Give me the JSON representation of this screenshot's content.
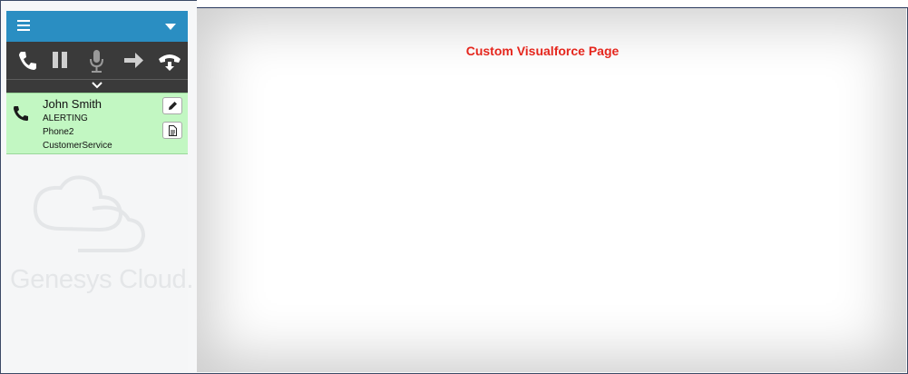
{
  "softphone": {
    "header": {
      "menu_icon": "hamburger-menu-icon",
      "dropdown_icon": "caret-down-icon"
    },
    "controls": [
      {
        "name": "call",
        "icon": "phone-icon"
      },
      {
        "name": "hold",
        "icon": "pause-icon"
      },
      {
        "name": "mute",
        "icon": "microphone-icon"
      },
      {
        "name": "transfer",
        "icon": "arrow-right-icon"
      },
      {
        "name": "disconnect",
        "icon": "hangup-icon"
      }
    ],
    "expand_icon": "chevron-down-icon",
    "interaction": {
      "name": "John Smith",
      "status": "ALERTING",
      "station": "Phone2",
      "queue": "CustomerService",
      "background_color": "#c2f7c2"
    },
    "brand": "Genesys Cloud."
  },
  "content": {
    "title": "Custom Visualforce Page",
    "title_color": "#e5261d"
  }
}
